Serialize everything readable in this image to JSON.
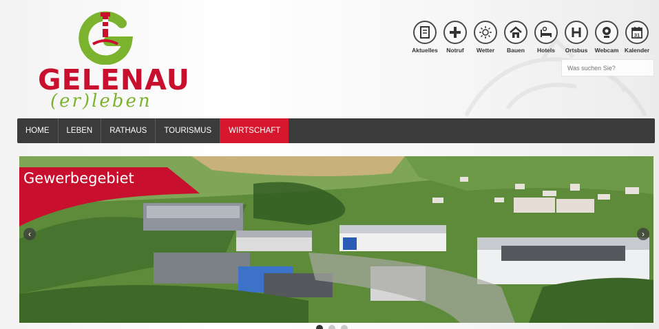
{
  "logo": {
    "name": "GELENAU",
    "tagline": "(er)leben"
  },
  "colors": {
    "brand_red": "#c8102e",
    "brand_green": "#7bb32e",
    "nav_background": "#3b3b3b",
    "nav_active": "#d7172e"
  },
  "quick_links": [
    {
      "label": "Aktuelles",
      "icon": "news-icon"
    },
    {
      "label": "Notruf",
      "icon": "plus-icon"
    },
    {
      "label": "Wetter",
      "icon": "sun-icon"
    },
    {
      "label": "Bauen",
      "icon": "house-icon"
    },
    {
      "label": "Hotels",
      "icon": "bed-icon"
    },
    {
      "label": "Ortsbus",
      "icon": "bus-stop-icon"
    },
    {
      "label": "Webcam",
      "icon": "webcam-icon"
    },
    {
      "label": "Kalender",
      "icon": "calendar-icon",
      "day": "31"
    }
  ],
  "search": {
    "placeholder": "Was suchen Sie?",
    "value": ""
  },
  "nav": {
    "items": [
      "HOME",
      "LEBEN",
      "RATHAUS",
      "TOURISMUS",
      "WIRTSCHAFT"
    ],
    "active": "WIRTSCHAFT"
  },
  "slider": {
    "slide_title": "Gewerbegebiet",
    "prev_symbol": "‹",
    "next_symbol": "›",
    "active_index": 0,
    "slide_count": 3
  }
}
